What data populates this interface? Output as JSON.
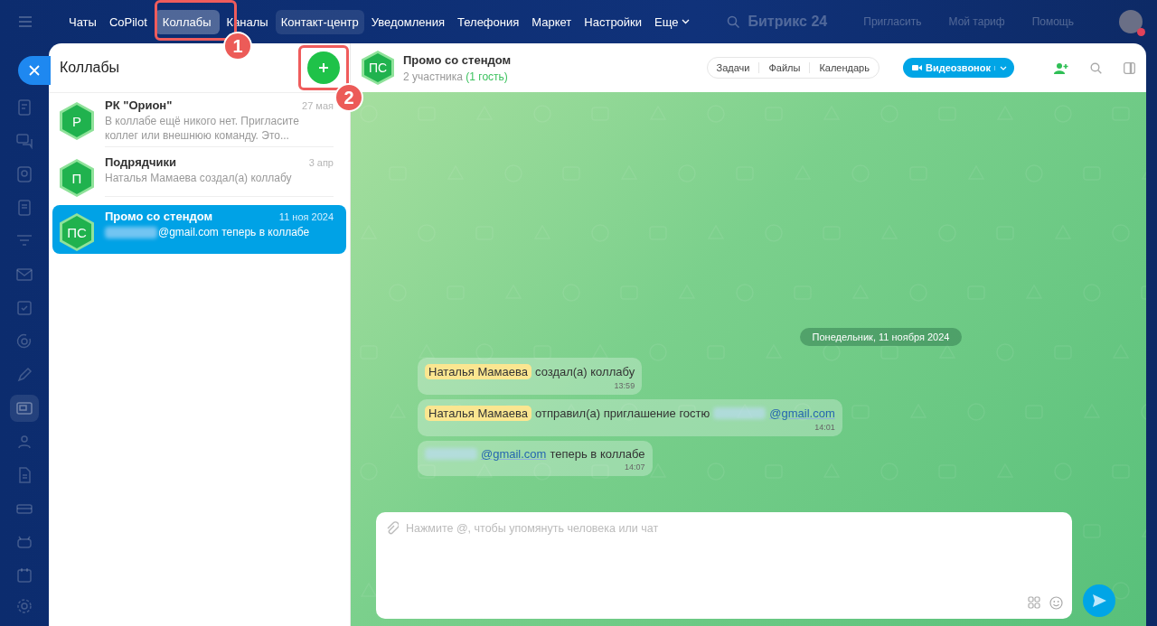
{
  "top_nav": {
    "items": [
      {
        "label": "Чаты",
        "selected": false,
        "hovered": false
      },
      {
        "label": "CoPilot",
        "selected": false,
        "hovered": false
      },
      {
        "label": "Коллабы",
        "selected": true,
        "hovered": false
      },
      {
        "label": "Каналы",
        "selected": false,
        "hovered": false
      },
      {
        "label": "Контакт-центр",
        "selected": false,
        "hovered": true
      },
      {
        "label": "Уведомления",
        "selected": false,
        "hovered": false
      },
      {
        "label": "Телефония",
        "selected": false,
        "hovered": false
      },
      {
        "label": "Маркет",
        "selected": false,
        "hovered": false
      },
      {
        "label": "Настройки",
        "selected": false,
        "hovered": false
      },
      {
        "label": "Еще",
        "selected": false,
        "hovered": false,
        "dropdown": true
      }
    ],
    "logo": "Битрикс 24",
    "actions": [
      "Пригласить",
      "Мой тариф",
      "Помощь"
    ]
  },
  "sidebar": {
    "items": [
      {
        "selected": false
      },
      {
        "selected": false
      },
      {
        "selected": false
      },
      {
        "selected": false
      },
      {
        "selected": false
      },
      {
        "selected": false
      },
      {
        "selected": false
      },
      {
        "selected": false
      },
      {
        "selected": false
      },
      {
        "selected": true
      },
      {
        "selected": false
      },
      {
        "selected": false
      },
      {
        "selected": false
      },
      {
        "selected": false
      },
      {
        "selected": false
      }
    ]
  },
  "chat_list": {
    "title": "Коллабы",
    "chats": [
      {
        "initials": "Р",
        "name": "РК \"Орион\"",
        "date": "27 мая",
        "preview": "В коллабе ещё никого нет. Пригласите коллег или внешнюю команду. Это...",
        "redacted": false,
        "selected": false
      },
      {
        "initials": "П",
        "name": "Подрядчики",
        "date": "3 апр",
        "preview": "Наталья Мамаева создал(а) коллабу",
        "redacted": false,
        "selected": false
      },
      {
        "initials": "ПС",
        "name": "Промо со стендом",
        "date": "11 ноя 2024",
        "preview": "@gmail.com теперь в коллабе",
        "redacted": true,
        "selected": true
      }
    ]
  },
  "chat": {
    "initials": "ПС",
    "title": "Промо со стендом",
    "members": "2 участника",
    "guests": "(1 гость)",
    "tabs": [
      "Задачи",
      "Файлы",
      "Календарь"
    ],
    "call_button": "Видеозвонок",
    "date_divider": "Понедельник, 11 ноября 2024",
    "messages": [
      {
        "author": "Наталья Мамаева",
        "text": "создал(а) коллабу",
        "time": "13:59"
      },
      {
        "author": "Наталья Мамаева",
        "text": "отправил(а) приглашение гостю",
        "redacted": true,
        "link": "@gmail.com",
        "time": "14:01"
      },
      {
        "redacted": true,
        "link": "@gmail.com",
        "text": "теперь в коллабе",
        "time": "14:07"
      }
    ],
    "composer": {
      "placeholder": "Нажмите @, чтобы упомянуть человека или чат"
    }
  },
  "annotations": [
    {
      "number": "1"
    },
    {
      "number": "2"
    }
  ]
}
